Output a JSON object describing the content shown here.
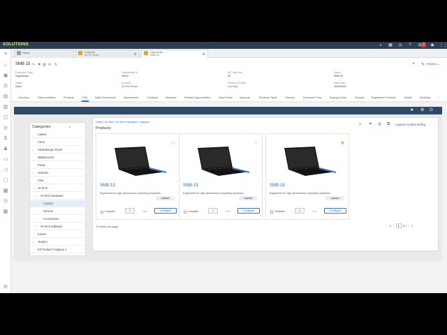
{
  "app": {
    "logo": "SOLUTIONS"
  },
  "tabs": [
    {
      "label": "Home"
    },
    {
      "label1": "Customer",
      "label2": "SLPW Center"
    },
    {
      "label1": "Opportunity",
      "label2": "SMB-15"
    }
  ],
  "topbar": {
    "notif_count": "2"
  },
  "record": {
    "title": "SMB 15",
    "fields": [
      {
        "label": "Document Type",
        "value": "Opportunity"
      },
      {
        "label": "Opportunity ID",
        "value": "49019"
      },
      {
        "label": "WF Step Info",
        "value": "20"
      },
      {
        "label": "Name",
        "value": "SMB 15"
      },
      {
        "label": "Status",
        "value": "Open"
      },
      {
        "label": "Account",
        "value": "ALPHA Center"
      },
      {
        "label": "Primary Contact",
        "value": "Lou Daly"
      },
      {
        "label": "Start Date",
        "value": "10/30/2019"
      }
    ],
    "actions_label": "Actions"
  },
  "sections": [
    "Overview",
    "Sales Activities",
    "Products",
    "CPQ",
    "Sales Documents",
    "Attachments",
    "Contracts",
    "Warranty",
    "Related Opportunities",
    "Sales Team",
    "Approval",
    "Revenue Splits",
    "Timeline",
    "Document Flow",
    "Buying Center",
    "Surveys",
    "Registered Products",
    "Tickets",
    "Workflow"
  ],
  "categories": {
    "title": "Categories",
    "items": [
      {
        "label": "Cables",
        "arrow": ""
      },
      {
        "label": "Cleva",
        "arrow": ""
      },
      {
        "label": "Heidelberger Druck",
        "arrow": ">"
      },
      {
        "label": "Mähdrescher",
        "arrow": ""
      },
      {
        "label": "Pump",
        "arrow": ""
      },
      {
        "label": "Vehicles",
        "arrow": ">"
      },
      {
        "label": "Vitra",
        "arrow": ""
      },
      {
        "label": "Hi-Tech",
        "arrow": "v"
      },
      {
        "label": "Hi-Tech Hardware",
        "arrow": "v"
      },
      {
        "label": "Laptops",
        "arrow": ""
      },
      {
        "label": "Servers",
        "arrow": ""
      },
      {
        "label": "Accessories",
        "arrow": ""
      },
      {
        "label": "Hi-Tech Software",
        "arrow": ">"
      },
      {
        "label": "Knives",
        "arrow": ""
      },
      {
        "label": "Textiles",
        "arrow": ">"
      },
      {
        "label": "E2 Product Category 1",
        "arrow": ""
      }
    ]
  },
  "products": {
    "breadcrumb": "Home / Hi-Tech / Hi-Tech Hardware / Laptops",
    "title": "Products",
    "guided_selling": "Laptops Guided Selling",
    "cards": [
      {
        "name": "SMB-13",
        "desc": "Engineered for high-performance computing anywhere.",
        "tag": "Laptops",
        "compare": "Compare",
        "qty": "1",
        "add": "Add",
        "configure": "Configure",
        "starred": false
      },
      {
        "name": "SMB-15",
        "desc": "Engineered for high-performance computing anywhere.",
        "tag": "Laptops",
        "compare": "Compare",
        "qty": "1",
        "add": "Add",
        "configure": "Configure",
        "starred": false
      },
      {
        "name": "SMB-18",
        "desc": "Engineered for high-performance computing anywhere.",
        "tag": "Laptops",
        "compare": "Compare",
        "qty": "1",
        "add": "Add",
        "configure": "Configure",
        "starred": true
      }
    ],
    "per_page_value": "10",
    "per_page_label": "items per page",
    "page": "1",
    "page_of": "of 1"
  },
  "colors": {
    "accent": "#2a6bb8",
    "header": "#2d4a6b",
    "star_empty": "#e8a530",
    "star_full": "#e8a530"
  }
}
